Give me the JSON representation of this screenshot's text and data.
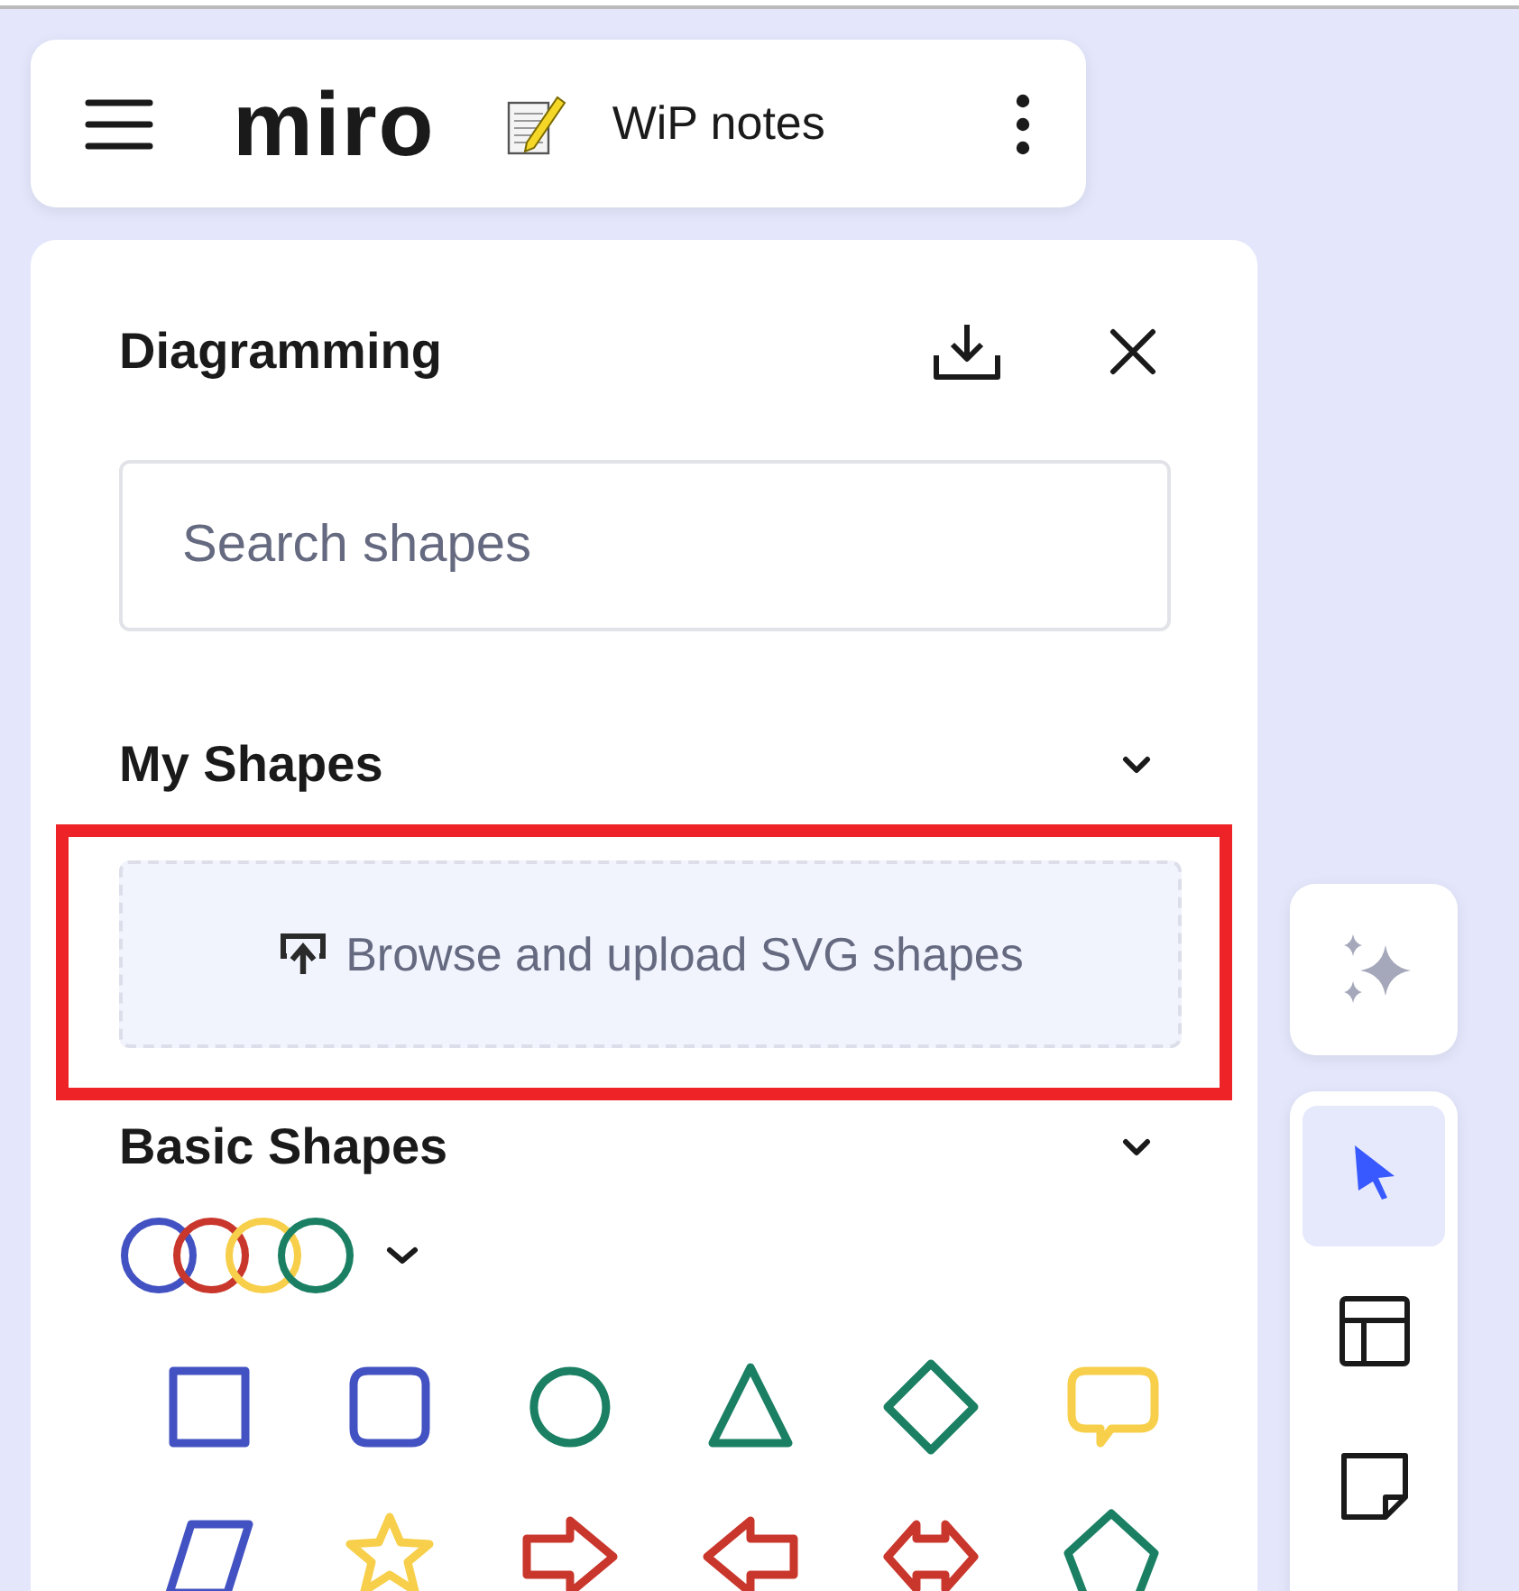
{
  "top_bar": {
    "logo": "miro",
    "board_name": "WiP notes"
  },
  "panel": {
    "title": "Diagramming",
    "search": {
      "placeholder": "Search shapes"
    },
    "sections": [
      {
        "title": "My Shapes",
        "expanded": true,
        "upload_label": "Browse and upload SVG shapes"
      },
      {
        "title": "Basic Shapes",
        "expanded": true
      }
    ],
    "palette": [
      {
        "color": "#4352c2"
      },
      {
        "color": "#c9362c"
      },
      {
        "color": "#f7cf4a"
      },
      {
        "color": "#1b8063"
      }
    ],
    "shapes": [
      {
        "kind": "square",
        "color": "#4352c2"
      },
      {
        "kind": "rounded",
        "color": "#4352c2"
      },
      {
        "kind": "circle",
        "color": "#1b8063"
      },
      {
        "kind": "triangle",
        "color": "#1b8063"
      },
      {
        "kind": "diamond",
        "color": "#1b8063"
      },
      {
        "kind": "bubble",
        "color": "#f7cf4a"
      },
      {
        "kind": "parallelogram",
        "color": "#4352c2"
      },
      {
        "kind": "star",
        "color": "#f7cf4a"
      },
      {
        "kind": "arrow-right",
        "color": "#c9362c"
      },
      {
        "kind": "arrow-left",
        "color": "#c9362c"
      },
      {
        "kind": "arrow-double",
        "color": "#c9362c"
      },
      {
        "kind": "pentagon",
        "color": "#1b8063"
      }
    ]
  },
  "toolbar": {
    "tools": [
      {
        "kind": "select",
        "selected": true
      },
      {
        "kind": "template",
        "selected": false
      },
      {
        "kind": "sticky",
        "selected": false
      }
    ]
  }
}
